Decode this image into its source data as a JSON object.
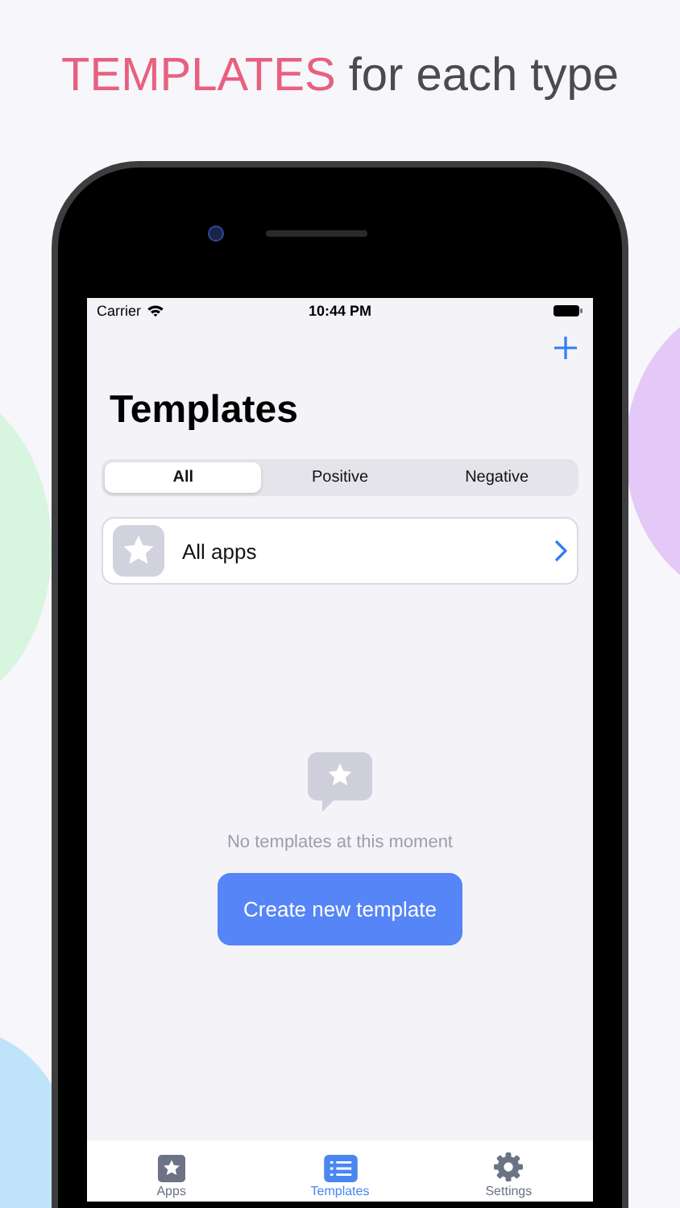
{
  "headline": {
    "highlight": "TEMPLATES",
    "rest": "for each type"
  },
  "status_bar": {
    "carrier": "Carrier",
    "time": "10:44 PM"
  },
  "title": "Templates",
  "segments": [
    {
      "label": "All",
      "selected": true
    },
    {
      "label": "Positive",
      "selected": false
    },
    {
      "label": "Negative",
      "selected": false
    }
  ],
  "list": [
    {
      "label": "All apps"
    }
  ],
  "empty_state": {
    "message": "No templates at this moment",
    "button": "Create new template"
  },
  "tab_bar": [
    {
      "label": "Apps",
      "selected": false,
      "kind": "star"
    },
    {
      "label": "Templates",
      "selected": true,
      "kind": "list"
    },
    {
      "label": "Settings",
      "selected": false,
      "kind": "gear"
    }
  ]
}
